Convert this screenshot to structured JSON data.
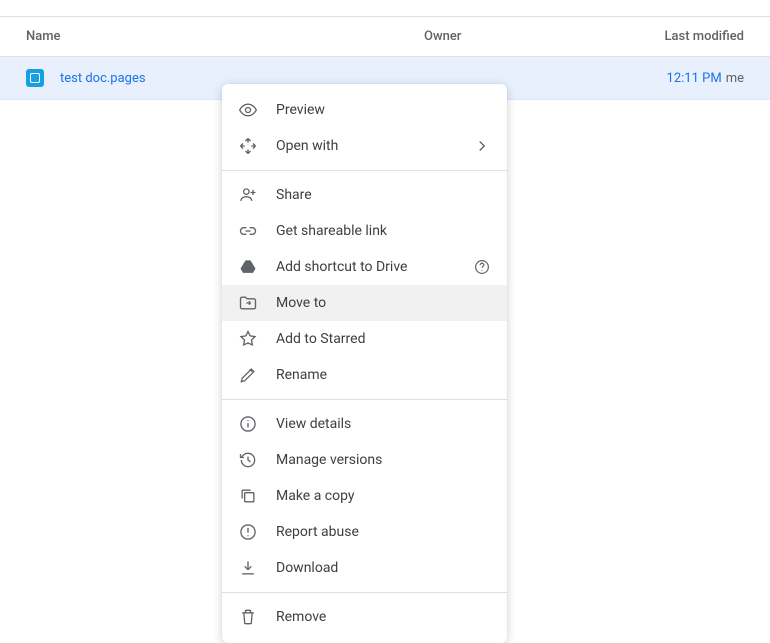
{
  "header": {
    "name": "Name",
    "owner": "Owner",
    "modified": "Last modified"
  },
  "file": {
    "name": "test doc.pages",
    "modified_time": "12:11 PM",
    "modified_by": "me"
  },
  "menu": {
    "preview": "Preview",
    "open_with": "Open with",
    "share": "Share",
    "get_link": "Get shareable link",
    "add_shortcut": "Add shortcut to Drive",
    "move_to": "Move to",
    "star": "Add to Starred",
    "rename": "Rename",
    "view_details": "View details",
    "manage_versions": "Manage versions",
    "make_copy": "Make a copy",
    "report_abuse": "Report abuse",
    "download": "Download",
    "remove": "Remove"
  }
}
